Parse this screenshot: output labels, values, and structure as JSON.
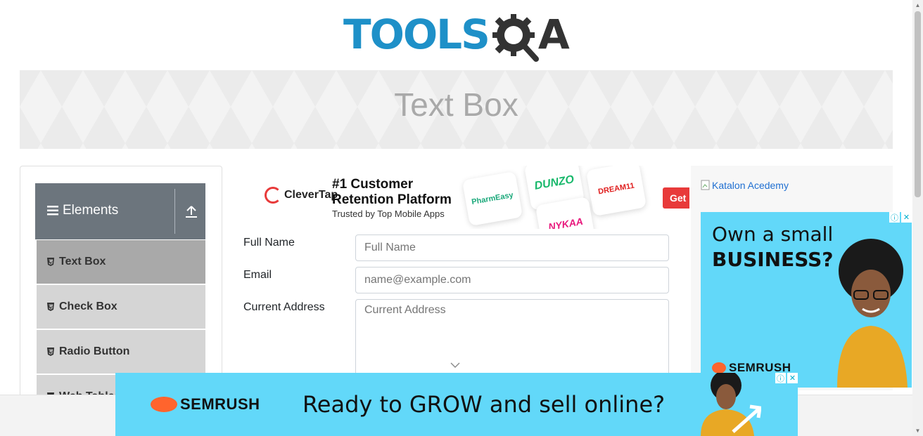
{
  "header": {
    "logo_text_tools": "TOOLS",
    "logo_text_a": "A"
  },
  "banner": {
    "title": "Text Box"
  },
  "sidebar": {
    "group_label": "Elements",
    "items": [
      {
        "label": "Text Box",
        "active": true
      },
      {
        "label": "Check Box",
        "active": false
      },
      {
        "label": "Radio Button",
        "active": false
      },
      {
        "label": "Web Tables",
        "active": false
      }
    ]
  },
  "ad_top": {
    "brand": "CleverTap",
    "headline_1": "#1 Customer",
    "headline_2": "Retention Platform",
    "subline": "Trusted by Top Mobile Apps",
    "tiles": [
      "PharmEasy",
      "DUNZO",
      "DREAM11",
      "NYKAA"
    ],
    "cta": "Get"
  },
  "form": {
    "full_name": {
      "label": "Full Name",
      "placeholder": "Full Name"
    },
    "email": {
      "label": "Email",
      "placeholder": "name@example.com"
    },
    "current_address": {
      "label": "Current Address",
      "placeholder": "Current Address"
    }
  },
  "right_ads": {
    "katalon_alt": "Katalon Acedemy",
    "semrush_headline_1": "Own a small",
    "semrush_headline_2": "BUSINESS?",
    "semrush_brand": "SEMRUSH"
  },
  "bottom_ad": {
    "brand": "SEMRUSH",
    "headline": "Ready to GROW and sell online?"
  },
  "colors": {
    "accent_blue": "#1e90c8",
    "semrush_bg": "#62d8f9",
    "sidebar_header": "#6c757d"
  }
}
